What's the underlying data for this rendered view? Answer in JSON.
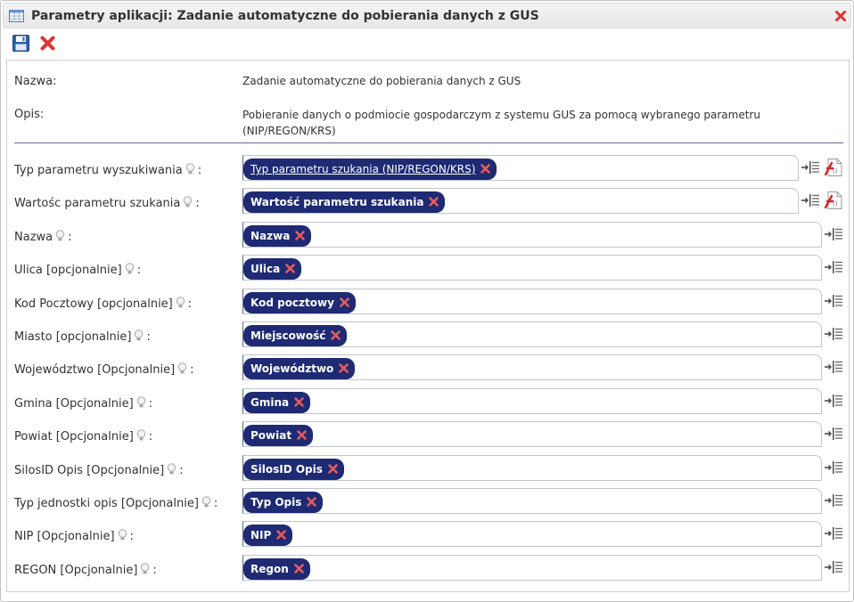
{
  "window": {
    "title": "Parametry aplikacji: Zadanie automatyczne do pobierania danych z GUS"
  },
  "info": {
    "name_label": "Nazwa:",
    "name_value": "Zadanie automatyczne do pobierania danych z GUS",
    "desc_label": "Opis:",
    "desc_value": "Pobieranie danych o podmiocie gospodarczym z systemu GUS za pomocą wybranego parametru (NIP/REGON/KRS)"
  },
  "params": [
    {
      "label": "Typ parametru wyszukiwania",
      "chip": "Typ parametru szukania (NIP/REGON/KRS)"
    },
    {
      "label": "Wartośc parametru szukania",
      "chip": "Wartość parametru szukania"
    },
    {
      "label": "Nazwa",
      "chip": "Nazwa"
    },
    {
      "label": "Ulica [opcjonalnie]",
      "chip": "Ulica"
    },
    {
      "label": "Kod Pocztowy [opcjonalnie]",
      "chip": "Kod pocztowy"
    },
    {
      "label": "Miasto [opcjonalnie]",
      "chip": "Miejscowość"
    },
    {
      "label": "Województwo [Opcjonalnie]",
      "chip": "Województwo"
    },
    {
      "label": "Gmina [Opcjonalnie]",
      "chip": "Gmina"
    },
    {
      "label": "Powiat [Opcjonalnie]",
      "chip": "Powiat"
    },
    {
      "label": "SilosID Opis [Opcjonalnie]",
      "chip": "SilosID Opis"
    },
    {
      "label": "Typ jednostki opis [Opcjonalnie]",
      "chip": "Typ Opis"
    },
    {
      "label": "NIP [Opcjonalnie]",
      "chip": "NIP"
    },
    {
      "label": "REGON [Opcjonalnie]",
      "chip": "Regon"
    }
  ],
  "label_suffix": ":",
  "colors": {
    "chip_bg": "#1e2a73",
    "remove_red": "#e03131",
    "save_blue": "#2b5ea8"
  }
}
